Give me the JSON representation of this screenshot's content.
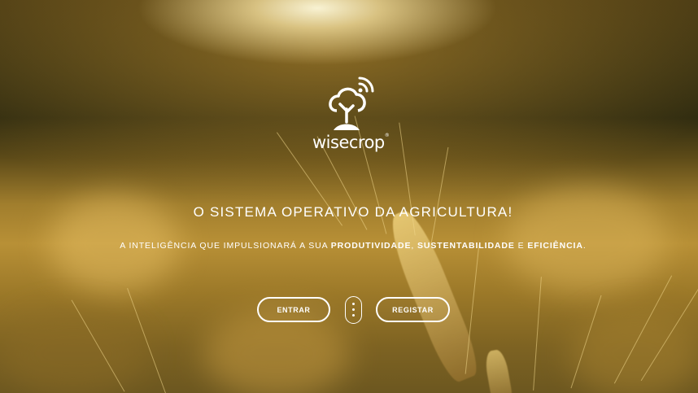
{
  "brand": {
    "name": "wisecrop",
    "registered_mark": "®"
  },
  "hero": {
    "headline": "O SISTEMA OPERATIVO DA AGRICULTURA!",
    "subline": {
      "prefix": "A INTELIGÊNCIA QUE IMPULSIONARÁ A SUA ",
      "highlight_1": "PRODUTIVIDADE",
      "sep_1": ", ",
      "highlight_2": "SUSTENTABILIDADE",
      "sep_2": " E ",
      "highlight_3": "EFICIÊNCIA",
      "suffix": "."
    }
  },
  "actions": {
    "login_label": "ENTRAR",
    "register_label": "REGISTAR"
  },
  "icons": {
    "logo": "tree-wifi-logo-icon",
    "scroll": "mouse-scroll-icon"
  },
  "colors": {
    "text": "#ffffff",
    "background_gold": "#b89036",
    "background_dark": "#2f2b10"
  }
}
